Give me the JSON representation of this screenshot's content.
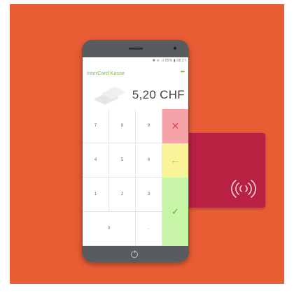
{
  "status_bar": {
    "text": "✱ ≋ .ıl 55% ▮ 08:27"
  },
  "app": {
    "title": "InterCard Kasse",
    "menu_icon": "more-dots-icon"
  },
  "display": {
    "amount": "5,20 CHF"
  },
  "keypad": {
    "k7": "7",
    "k8": "8",
    "k9": "9",
    "k4": "4",
    "k5": "5",
    "k6": "6",
    "k1": "1",
    "k2": "2",
    "k3": "3",
    "k0": "0",
    "kdot": ".",
    "cancel": "✕",
    "back": "←",
    "ok": "✓"
  },
  "colors": {
    "background": "#e95d35",
    "card": "#b92143",
    "accent": "#7cb946",
    "cancel": "#f5a3a8",
    "backspace": "#f9f39a",
    "confirm": "#c9f5a8"
  },
  "icons": {
    "card_icon": "nfc-contactless-icon",
    "home_icon": "power-icon"
  }
}
